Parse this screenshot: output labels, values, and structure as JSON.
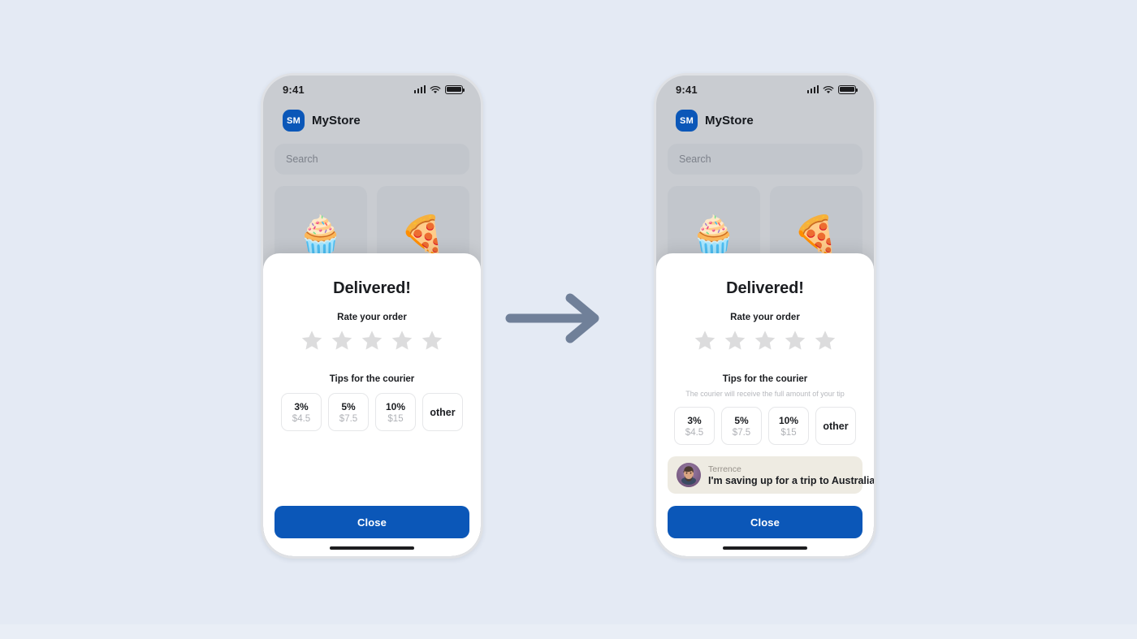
{
  "background_color": "#e4eaf4",
  "accent_color": "#0b57b8",
  "arrow": {
    "icon": "arrow-right-icon",
    "color": "#708099"
  },
  "phones": [
    {
      "variant": "before",
      "status_bar": {
        "time": "9:41",
        "signal_icon": "cellular-signal-icon",
        "wifi_icon": "wifi-icon",
        "battery_icon": "battery-full-icon"
      },
      "header": {
        "logo_initials": "SM",
        "store_name": "MyStore"
      },
      "search": {
        "placeholder": "Search",
        "value": ""
      },
      "tiles": [
        {
          "icon": "cupcake-emoji",
          "glyph": "🧁"
        },
        {
          "icon": "pizza-emoji",
          "glyph": "🍕"
        }
      ],
      "sheet": {
        "title": "Delivered!",
        "rating_label": "Rate your order",
        "stars_total": 5,
        "stars_selected": 0,
        "tips_label": "Tips for the courier",
        "tips_note": "",
        "show_tips_note": false,
        "tips": [
          {
            "percent": "3%",
            "amount": "$4.5"
          },
          {
            "percent": "5%",
            "amount": "$7.5"
          },
          {
            "percent": "10%",
            "amount": "$15"
          }
        ],
        "tip_other_label": "other",
        "courier_message": null,
        "show_courier_message": false,
        "close_label": "Close"
      }
    },
    {
      "variant": "after",
      "status_bar": {
        "time": "9:41",
        "signal_icon": "cellular-signal-icon",
        "wifi_icon": "wifi-icon",
        "battery_icon": "battery-full-icon"
      },
      "header": {
        "logo_initials": "SM",
        "store_name": "MyStore"
      },
      "search": {
        "placeholder": "Search",
        "value": ""
      },
      "tiles": [
        {
          "icon": "cupcake-emoji",
          "glyph": "🧁"
        },
        {
          "icon": "pizza-emoji",
          "glyph": "🍕"
        }
      ],
      "sheet": {
        "title": "Delivered!",
        "rating_label": "Rate your order",
        "stars_total": 5,
        "stars_selected": 0,
        "tips_label": "Tips for the courier",
        "tips_note": "The courier will receive the full amount of your tip",
        "show_tips_note": true,
        "tips": [
          {
            "percent": "3%",
            "amount": "$4.5"
          },
          {
            "percent": "5%",
            "amount": "$7.5"
          },
          {
            "percent": "10%",
            "amount": "$15"
          }
        ],
        "tip_other_label": "other",
        "courier_message": {
          "name": "Terrence",
          "text": "I'm saving up for a trip to Australia",
          "avatar": "courier-avatar-photo",
          "card_color": "#eeebe2"
        },
        "show_courier_message": true,
        "close_label": "Close"
      }
    }
  ]
}
